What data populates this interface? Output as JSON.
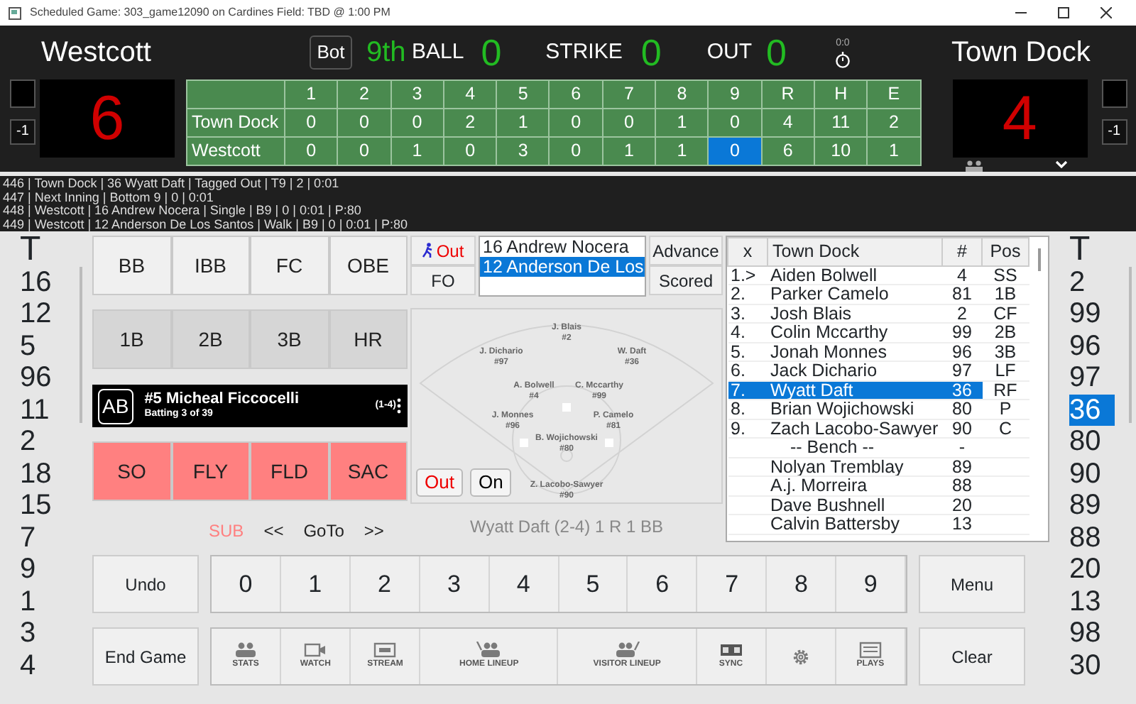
{
  "window": {
    "title": "Scheduled Game: 303_game12090 on Cardines Field: TBD @ 1:00 PM"
  },
  "scoreboard": {
    "visitor_name": "Westcott",
    "home_name": "Town Dock",
    "half": "Bot",
    "inning": "9th",
    "ball_label": "BALL",
    "balls": "0",
    "strike_label": "STRIKE",
    "strikes": "0",
    "out_label": "OUT",
    "outs": "0",
    "clock": "0:0",
    "left_score": "6",
    "right_score": "4",
    "left_minus": "-1",
    "right_minus": "-1"
  },
  "linescore": {
    "columns": [
      "1",
      "2",
      "3",
      "4",
      "5",
      "6",
      "7",
      "8",
      "9",
      "R",
      "H",
      "E"
    ],
    "rows": [
      {
        "team": "Town Dock",
        "cells": [
          {
            "value": "0",
            "selected": false
          },
          {
            "value": "0",
            "selected": false
          },
          {
            "value": "0",
            "selected": false
          },
          {
            "value": "2",
            "selected": false
          },
          {
            "value": "1",
            "selected": false
          },
          {
            "value": "0",
            "selected": false
          },
          {
            "value": "0",
            "selected": false
          },
          {
            "value": "1",
            "selected": false
          },
          {
            "value": "0",
            "selected": false
          },
          {
            "value": "4",
            "selected": false
          },
          {
            "value": "11",
            "selected": false
          },
          {
            "value": "2",
            "selected": false
          }
        ]
      },
      {
        "team": "Westcott",
        "cells": [
          {
            "value": "0",
            "selected": false
          },
          {
            "value": "0",
            "selected": false
          },
          {
            "value": "1",
            "selected": false
          },
          {
            "value": "0",
            "selected": false
          },
          {
            "value": "3",
            "selected": false
          },
          {
            "value": "0",
            "selected": false
          },
          {
            "value": "1",
            "selected": false
          },
          {
            "value": "1",
            "selected": false
          },
          {
            "value": "0",
            "selected": true
          },
          {
            "value": "6",
            "selected": false
          },
          {
            "value": "10",
            "selected": false
          },
          {
            "value": "1",
            "selected": false
          }
        ]
      }
    ]
  },
  "log": [
    "446 | Town Dock | 36 Wyatt Daft | Tagged Out | T9 | 2 | 0:01",
    "447 | Next Inning | Bottom 9 | 0 | 0:01",
    "448 | Westcott | 16 Andrew Nocera | Single | B9 | 0 | 0:01 | P:80",
    "449 | Westcott | 12 Anderson De Los Santos | Walk | B9 | 0 | 0:01 | P:80"
  ],
  "left_numbers": {
    "header": "T",
    "items": [
      {
        "label": "16",
        "selected": false
      },
      {
        "label": "12",
        "selected": false
      },
      {
        "label": "5",
        "selected": false
      },
      {
        "label": "96",
        "selected": false
      },
      {
        "label": "11",
        "selected": false
      },
      {
        "label": "2",
        "selected": false
      },
      {
        "label": "18",
        "selected": false
      },
      {
        "label": "15",
        "selected": false
      },
      {
        "label": "7",
        "selected": false
      },
      {
        "label": "9",
        "selected": false
      },
      {
        "label": "1",
        "selected": false
      },
      {
        "label": "3",
        "selected": false
      },
      {
        "label": "4",
        "selected": false
      }
    ]
  },
  "right_numbers": {
    "header": "T",
    "items": [
      {
        "label": "2",
        "selected": false
      },
      {
        "label": "99",
        "selected": false
      },
      {
        "label": "96",
        "selected": false
      },
      {
        "label": "97",
        "selected": false
      },
      {
        "label": "36",
        "selected": true
      },
      {
        "label": "80",
        "selected": false
      },
      {
        "label": "90",
        "selected": false
      },
      {
        "label": "89",
        "selected": false
      },
      {
        "label": "88",
        "selected": false
      },
      {
        "label": "20",
        "selected": false
      },
      {
        "label": "13",
        "selected": false
      },
      {
        "label": "98",
        "selected": false
      },
      {
        "label": "30",
        "selected": false
      }
    ]
  },
  "button_rows": [
    {
      "kind": "walk",
      "buttons": [
        "BB",
        "IBB",
        "FC",
        "OBE"
      ]
    },
    {
      "kind": "hit",
      "buttons": [
        "1B",
        "2B",
        "3B",
        "HR"
      ]
    },
    {
      "kind": "out",
      "buttons": [
        "SO",
        "FLY",
        "FLD",
        "SAC"
      ]
    }
  ],
  "at_bat": {
    "badge": "AB",
    "title": "#5 Micheal Ficcocelli",
    "subtitle": "Batting 3 of 39",
    "count": "(1-4)"
  },
  "navigation": {
    "sub": "SUB",
    "prev": "<<",
    "goto": "GoTo",
    "next": ">>"
  },
  "runner_panel": {
    "out_button": "Out",
    "fo_button": "FO",
    "runners": [
      {
        "label": "16 Andrew Nocera",
        "selected": false
      },
      {
        "label": "12 Anderson De Los",
        "selected": true
      }
    ],
    "advance_button": "Advance",
    "scored_button": "Scored"
  },
  "field": {
    "positions": [
      {
        "name": "J. Blais",
        "number": "#2"
      },
      {
        "name": "J. Dichario",
        "number": "#97"
      },
      {
        "name": "W. Daft",
        "number": "#36"
      },
      {
        "name": "A. Bolwell",
        "number": "#4"
      },
      {
        "name": "C. Mccarthy",
        "number": "#99"
      },
      {
        "name": "J. Monnes",
        "number": "#96"
      },
      {
        "name": "P. Camelo",
        "number": "#81"
      },
      {
        "name": "B. Wojichowski",
        "number": "#80"
      },
      {
        "name": "Z. Lacobo-Sawyer",
        "number": "#90"
      }
    ],
    "out_button": "Out",
    "on_button": "On",
    "summary": "Wyatt Daft  (2-4) 1 R 1 BB"
  },
  "roster": {
    "columns": [
      "x",
      "Town Dock",
      "#",
      "Pos"
    ],
    "rows": [
      {
        "kind": "player",
        "order": "1.>",
        "name": "Aiden Bolwell",
        "number": "4",
        "pos": "SS",
        "selected": false
      },
      {
        "kind": "player",
        "order": "2.",
        "name": "Parker Camelo",
        "number": "81",
        "pos": "1B",
        "selected": false
      },
      {
        "kind": "player",
        "order": "3.",
        "name": "Josh Blais",
        "number": "2",
        "pos": "CF",
        "selected": false
      },
      {
        "kind": "player",
        "order": "4.",
        "name": "Colin Mccarthy",
        "number": "99",
        "pos": "2B",
        "selected": false
      },
      {
        "kind": "player",
        "order": "5.",
        "name": "Jonah Monnes",
        "number": "96",
        "pos": "3B",
        "selected": false
      },
      {
        "kind": "player",
        "order": "6.",
        "name": "Jack Dichario",
        "number": "97",
        "pos": "LF",
        "selected": false
      },
      {
        "kind": "player",
        "order": "7.",
        "name": "Wyatt Daft",
        "number": "36",
        "pos": "RF",
        "selected": true
      },
      {
        "kind": "player",
        "order": "8.",
        "name": "Brian Wojichowski",
        "number": "80",
        "pos": "P",
        "selected": false
      },
      {
        "kind": "player",
        "order": "9.",
        "name": "Zach Lacobo-Sawyer",
        "number": "90",
        "pos": "C",
        "selected": false
      },
      {
        "kind": "divider",
        "name": "--  Bench  --",
        "number": "-",
        "selected": false
      },
      {
        "kind": "player",
        "name": "Nolyan Tremblay",
        "number": "89",
        "selected": false
      },
      {
        "kind": "player",
        "name": "A.j. Morreira",
        "number": "88",
        "selected": false
      },
      {
        "kind": "player",
        "name": "Dave Bushnell",
        "number": "20",
        "selected": false
      },
      {
        "kind": "player",
        "name": "Calvin Battersby",
        "number": "13",
        "selected": false
      }
    ]
  },
  "controls": {
    "undo": "Undo",
    "digits": [
      "0",
      "1",
      "2",
      "3",
      "4",
      "5",
      "6",
      "7",
      "8",
      "9"
    ],
    "menu": "Menu",
    "end_game": "End Game",
    "clear": "Clear",
    "tools": [
      {
        "kind": "stats",
        "label": "STATS"
      },
      {
        "kind": "watch",
        "label": "WATCH"
      },
      {
        "kind": "stream",
        "label": "STREAM"
      },
      {
        "kind": "home-lineup",
        "label": "HOME LINEUP"
      },
      {
        "kind": "visitor-lineup",
        "label": "VISITOR LINEUP"
      },
      {
        "kind": "sync",
        "label": "SYNC"
      },
      {
        "kind": "settings"
      },
      {
        "kind": "plays",
        "label": "PLAYS"
      }
    ]
  }
}
